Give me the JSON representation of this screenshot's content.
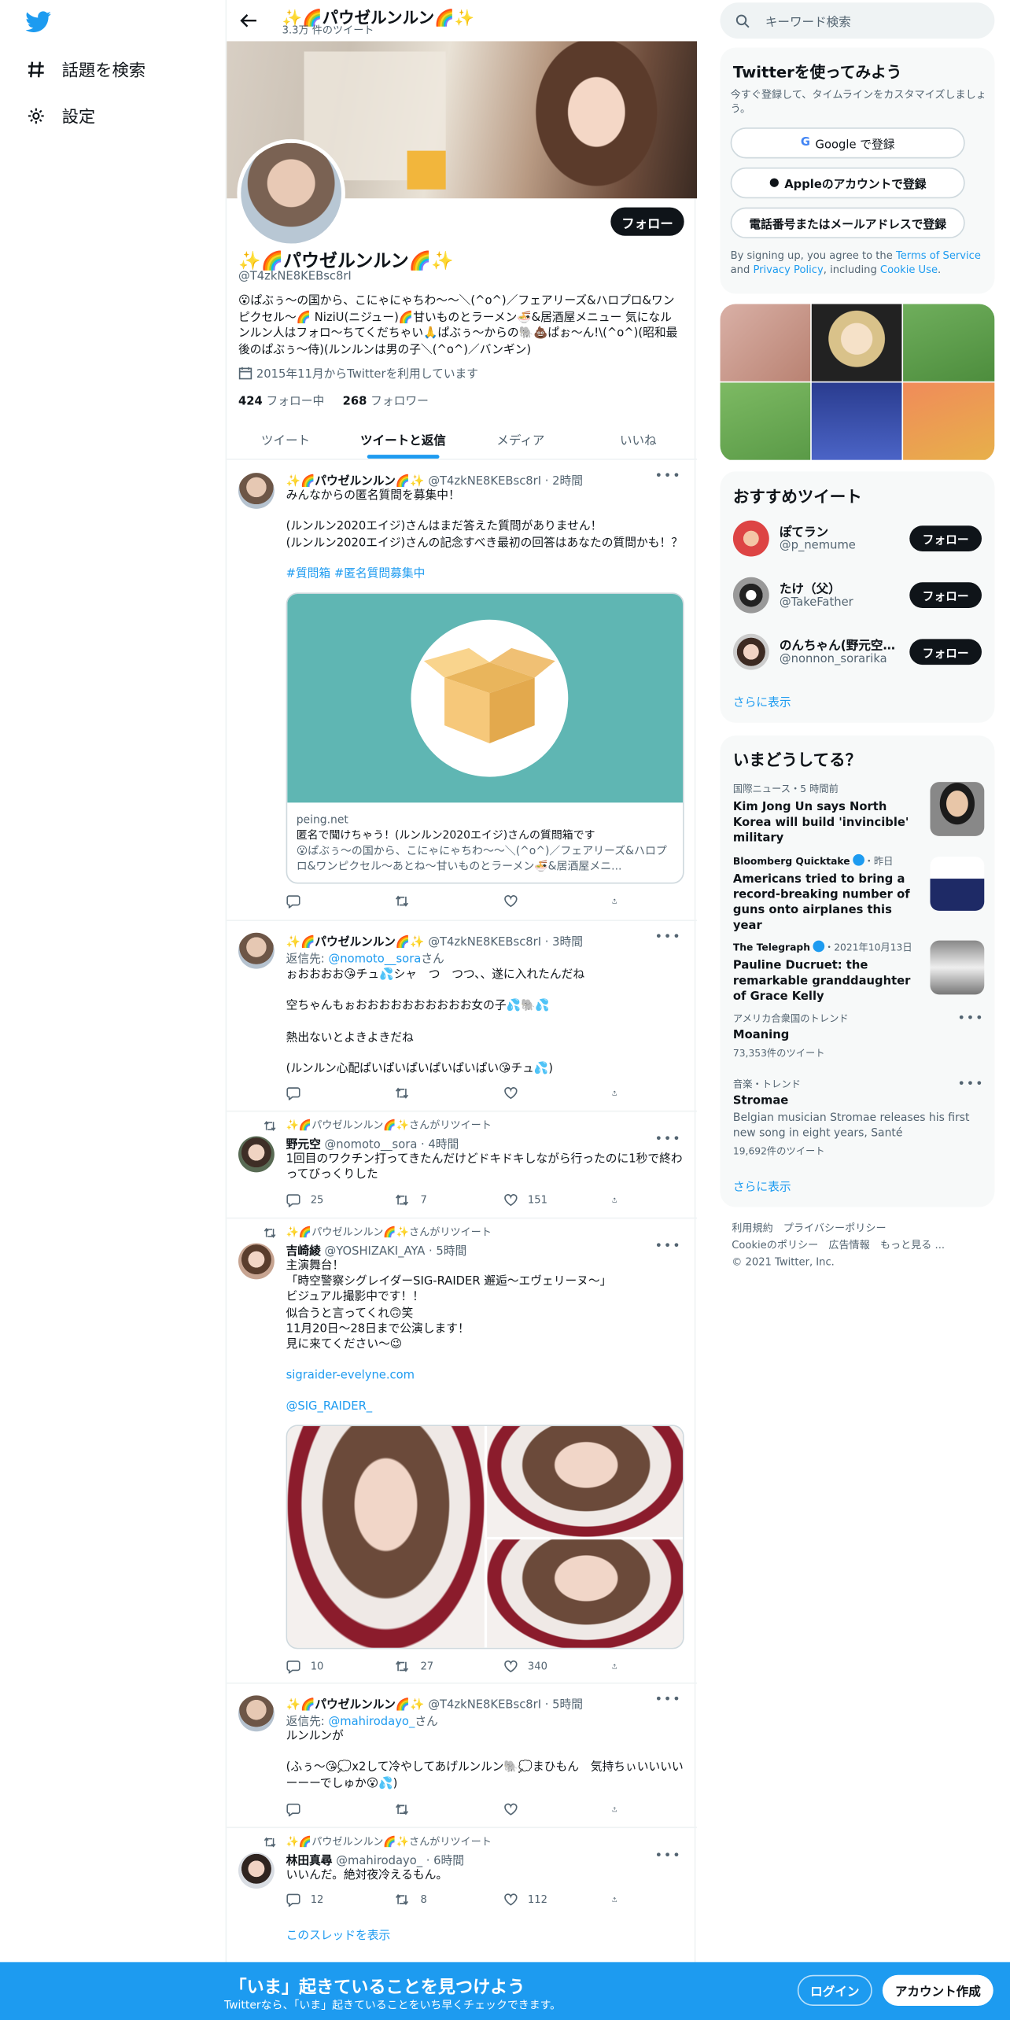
{
  "nav": {
    "explore": "話題を検索",
    "settings": "設定"
  },
  "header": {
    "title": "✨🌈パウゼルンルン🌈✨",
    "tweet_count": "3.3万 件のツイート"
  },
  "profile": {
    "follow": "フォロー",
    "name": "✨🌈パウゼルンルン🌈✨",
    "handle": "@T4zkNE8KEBsc8rI",
    "bio": "😮ぱぶぅ〜の国から、こにゃにゃちわ〜〜＼(^o^)／フェアリーズ&ハロプロ&ワンピクセル〜🌈 NiziU(ニジュー)🌈甘いものとラーメン🍜&居酒屋メニュー 気になルンルン人はフォロ〜ちてくだちゃい🙏ぱぶぅ〜からの🐘💩ぱぉ〜ん!\\(^o^)(昭和最後のぱぶぅ〜侍)(ルンルンは男の子＼(^o^)／バンギン)",
    "joined": "2015年11月からTwitterを利用しています",
    "following_count": "424",
    "following_label": "フォロー中",
    "followers_count": "268",
    "followers_label": "フォロワー"
  },
  "tabs": [
    "ツイート",
    "ツイートと返信",
    "メディア",
    "いいね"
  ],
  "tweets": [
    {
      "name": "✨🌈パウゼルンルン🌈✨",
      "meta": "@T4zkNE8KEBsc8rI · 2時間",
      "text": "みんなからの匿名質問を募集中！\n\n(ルンルン2020エイジ)さんはまだ答えた質問がありません！\n(ルンルン2020エイジ)さんの記念すべき最初の回答はあなたの質問かも！？",
      "hashtags": "#質問箱 #匿名質問募集中",
      "card": {
        "domain": "peing.net",
        "title": "匿名で聞けちゃう！(ルンルン2020エイジ)さんの質問箱です",
        "desc": "😮ぱぶぅ〜の国から、こにゃにゃちわ〜〜＼(^o^)／フェアリーズ&ハロプロ&ワンピクセル〜あとね〜甘いものとラーメン🍜&居酒屋メニ..."
      }
    },
    {
      "name": "✨🌈パウゼルンルン🌈✨",
      "meta": "@T4zkNE8KEBsc8rI · 3時間",
      "reply_prefix": "返信先: ",
      "reply_to": "@nomoto__sora",
      "reply_suffix": "さん",
      "text": "ぉおおおお😘チュ💦シャ　つ　つつ、、遂に入れたんだね\n\n空ちゃんもぉおおおおおおおおおお女の子💦🐘💦\n\n熱出ないとよきよきだね\n\n(ルンルン心配ぱいぱいぱいぱいぱいぱい😘チュ💦)"
    },
    {
      "rt": "✨🌈パウゼルンルン🌈✨さんがリツイート",
      "name": "野元空",
      "meta": "@nomoto__sora · 4時間",
      "text": "1回目のワクチン打ってきたんだけどドキドキしながら行ったのに1秒で終わってびっくりした",
      "replies": "25",
      "retweets": "7",
      "likes": "151"
    },
    {
      "rt": "✨🌈パウゼルンルン🌈✨さんがリツイート",
      "name": "吉崎綾",
      "meta": "@YOSHIZAKI_AYA · 5時間",
      "text": "主演舞台！\n「時空警察シグレイダーSIG-RAIDER 邂逅～エヴェリーヌ～」\nビジュアル撮影中です！！\n似合うと言ってくれ🙃笑\n11月20日〜28日まで公演します！\n見に来てください〜😉",
      "link1": "sigraider-evelyne.com",
      "link2": "@SIG_RAIDER_",
      "replies": "10",
      "retweets": "27",
      "likes": "340"
    },
    {
      "name": "✨🌈パウゼルンルン🌈✨",
      "meta": "@T4zkNE8KEBsc8rI · 5時間",
      "reply_prefix": "返信先: ",
      "reply_to": "@mahirodayo_",
      "reply_suffix": "さん",
      "text": "ルンルンが\n\n(ふぅ〜😘💭x2して冷やしてあげルンルン🐘💭まひもん　気持ちぃいいいいーーーでしゅか😮💦)"
    },
    {
      "rt": "✨🌈パウゼルンルン🌈✨さんがリツイート",
      "name": "林田真尋",
      "meta": "@mahirodayo_ · 6時間",
      "text": "いいんだ。絶対夜冷えるもん。",
      "replies": "12",
      "retweets": "8",
      "likes": "112",
      "thread": "このスレッドを表示"
    }
  ],
  "right": {
    "search_placeholder": "キーワード検索",
    "signup_title": "Twitterを使ってみよう",
    "signup_sub": "今すぐ登録して、タイムラインをカスタマイズしましょう。",
    "google": "Google で登録",
    "apple": "Appleのアカウントで登録",
    "phone": "電話番号またはメールアドレスで登録",
    "legal_pre": "By signing up, you agree to the ",
    "legal_tos": "Terms of Service",
    "legal_and": " and ",
    "legal_privacy": "Privacy Policy",
    "legal_inc": ", including ",
    "legal_cookie": "Cookie Use",
    "legal_end": ".",
    "recommend_title": "おすすめツイート",
    "recommend": [
      {
        "name": "ぽてラン",
        "handle": "@p_nemume",
        "follow": "フォロー"
      },
      {
        "name": "たけ（父）",
        "handle": "@TakeFather",
        "follow": "フォロー"
      },
      {
        "name": "のんちゃん(野元空生...",
        "handle": "@nonnon_sorarika",
        "follow": "フォロー"
      }
    ],
    "show_more": "さらに表示",
    "trends_title": "いまどうしてる？",
    "trends": [
      {
        "cat": "国際ニュース・5 時間前",
        "title": "Kim Jong Un says North Korea will build 'invincible' military"
      },
      {
        "source": "Bloomberg Quicktake",
        "cat": "・昨日",
        "title": "Americans tried to bring a record-breaking number of guns onto airplanes this year"
      },
      {
        "source": "The Telegraph",
        "cat": "・2021年10月13日",
        "title": "Pauline Ducruet: the remarkable granddaughter of Grace Kelly"
      },
      {
        "cat": "アメリカ合衆国のトレンド",
        "title": "Moaning",
        "count": "73,353件のツイート"
      },
      {
        "cat": "音楽・トレンド",
        "title": "Stromae",
        "desc": "Belgian musician Stromae releases his first new song in eight years, Santé",
        "count": "19,692件のツイート"
      }
    ],
    "show_more2": "さらに表示",
    "footer_line1": "利用規約　プライバシーポリシー",
    "footer_line2": "Cookieのポリシー　広告情報　もっと見る ...",
    "footer_line3": "© 2021 Twitter, Inc."
  },
  "bottom": {
    "title": "「いま」起きていることを見つけよう",
    "sub": "Twitterなら、「いま」起きていることをいち早くチェックできます。",
    "login": "ログイン",
    "signup": "アカウント作成"
  },
  "colors": {
    "accent": "#1d9bf0",
    "text": "#0f1419",
    "secondary": "#536471"
  }
}
